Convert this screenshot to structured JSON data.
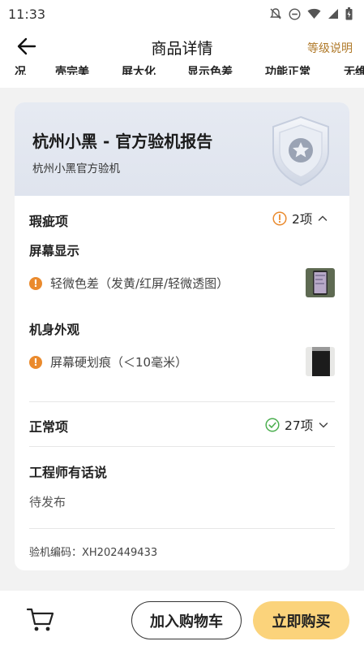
{
  "status_bar": {
    "time": "11:33",
    "icons": [
      "bell-off-icon",
      "do-not-disturb-icon",
      "wifi-icon",
      "signal-icon",
      "battery-icon"
    ]
  },
  "header": {
    "title": "商品详情",
    "right_link": "等级说明"
  },
  "tabs": [
    "况",
    "壳完美",
    "屏大化",
    "显示色差",
    "功能正常",
    "无维"
  ],
  "report": {
    "title": "杭州小黑 - 官方验机报告",
    "subtitle": "杭州小黑官方验机",
    "badge_icon": "shield-star-icon"
  },
  "defects": {
    "title": "瑕疵项",
    "count": "2项",
    "groups": [
      {
        "title": "屏幕显示",
        "items": [
          {
            "text": "轻微色差（发黄/红屏/轻微透图）",
            "thumb": "phone-screen-thumbnail"
          }
        ]
      },
      {
        "title": "机身外观",
        "items": [
          {
            "text": "屏幕硬划痕（＜10毫米）",
            "thumb": "phone-back-thumbnail"
          }
        ]
      }
    ]
  },
  "normal": {
    "title": "正常项",
    "count": "27项"
  },
  "engineer": {
    "title": "工程师有话说",
    "text": "待发布"
  },
  "inspection_code": "验机编码：XH202449433",
  "bottom_bar": {
    "add_to_cart": "加入购物车",
    "buy_now": "立即购买"
  },
  "colors": {
    "accent_gold": "#b07a2a",
    "warning_orange": "#ea8a2d",
    "ok_green": "#4caf50",
    "buy_button": "#fbd37b"
  }
}
